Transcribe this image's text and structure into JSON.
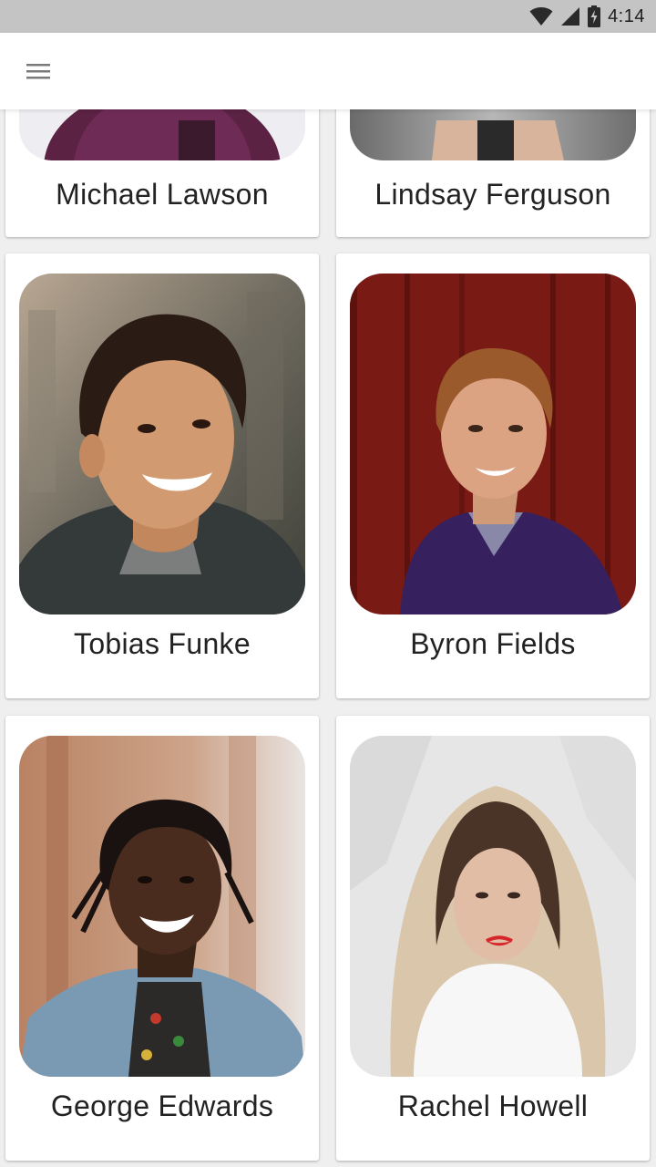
{
  "status_bar": {
    "time": "4:14",
    "icons": [
      "wifi-icon",
      "cellular-signal-icon",
      "battery-charging-icon"
    ]
  },
  "app_bar": {
    "menu_icon": "hamburger-menu-icon"
  },
  "people": [
    {
      "name": "Michael Lawson",
      "photo": "portrait-photo"
    },
    {
      "name": "Lindsay Ferguson",
      "photo": "portrait-photo"
    },
    {
      "name": "Tobias Funke",
      "photo": "portrait-photo"
    },
    {
      "name": "Byron Fields",
      "photo": "portrait-photo"
    },
    {
      "name": "George Edwards",
      "photo": "portrait-photo"
    },
    {
      "name": "Rachel Howell",
      "photo": "portrait-photo"
    }
  ],
  "colors": {
    "status_bar": "#c4c4c4",
    "app_bar": "#ffffff",
    "background": "#efefef",
    "card": "#ffffff",
    "name_text": "#222222"
  }
}
